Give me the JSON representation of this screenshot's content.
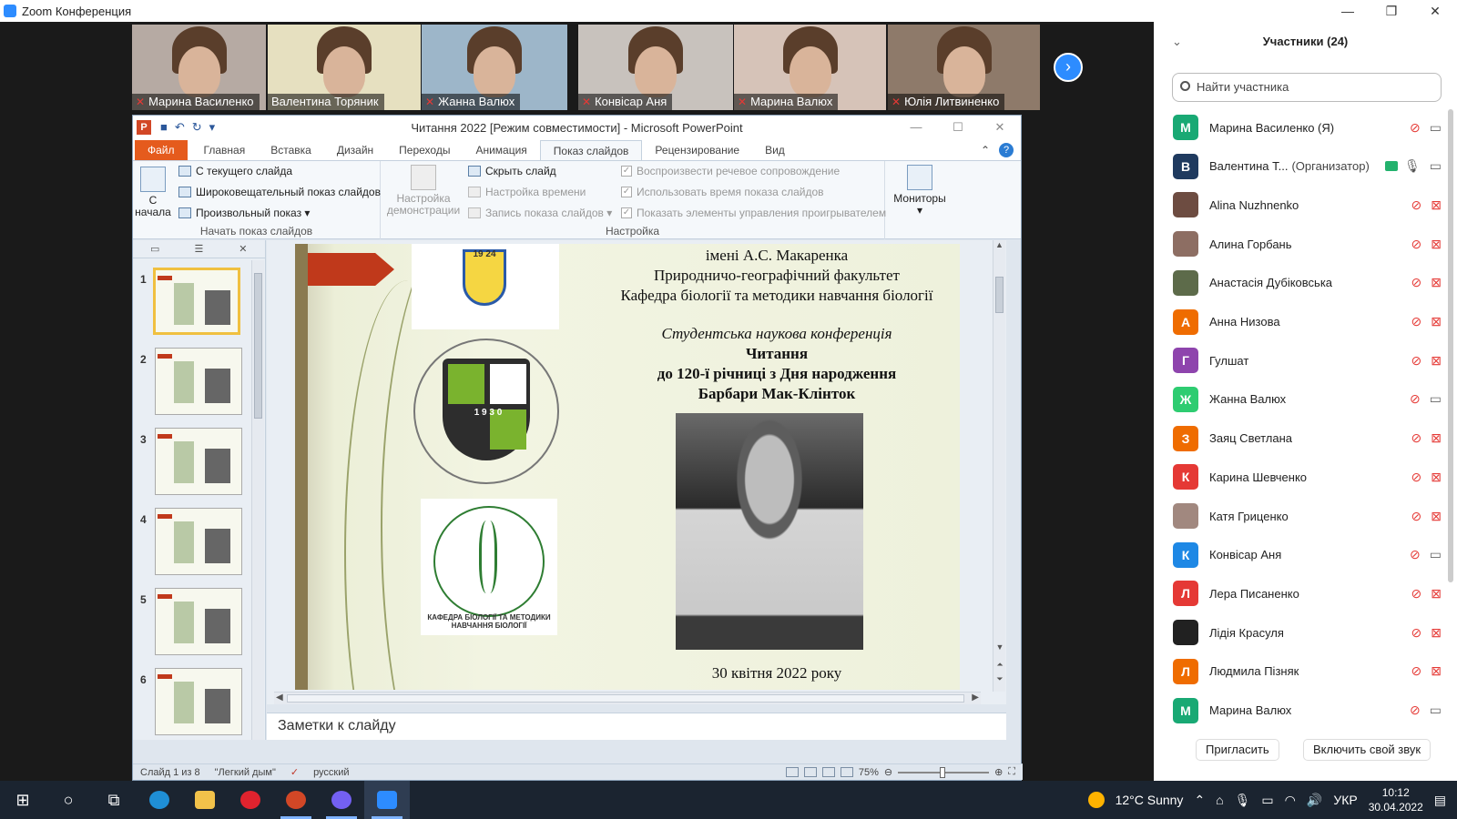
{
  "zoom": {
    "window_title": "Zoom Конференция",
    "window_controls": {
      "minimize": "—",
      "maximize": "❐",
      "close": "✕"
    },
    "gallery": [
      {
        "name": "Марина Василенко",
        "muted": true,
        "bg": "#b6aaa3"
      },
      {
        "name": "Валентина Торяник",
        "muted": false,
        "bg": "#e6e0c0"
      },
      {
        "name": "Жанна Валюх",
        "muted": true,
        "bg": "#9db6c9"
      },
      {
        "name": "Конвісар Аня",
        "muted": true,
        "bg": "#c8c2bd"
      },
      {
        "name": "Марина Валюх",
        "muted": true,
        "bg": "#d6c3b8"
      },
      {
        "name": "Юлія Литвиненко",
        "muted": true,
        "bg": "#8e7a6a"
      }
    ],
    "next_icon": "chevron-right-icon"
  },
  "ppt": {
    "title": "Читання 2022 [Режим совместимости] - Microsoft PowerPoint",
    "app_letter": "P",
    "tabs": [
      "Файл",
      "Главная",
      "Вставка",
      "Дизайн",
      "Переходы",
      "Анимация",
      "Показ слайдов",
      "Рецензирование",
      "Вид"
    ],
    "active_tab": "Показ слайдов",
    "ribbon": {
      "from_start_line1": "С",
      "from_start_line2": "начала",
      "from_current": "С текущего слайда",
      "broadcast": "Широковещательный показ слайдов",
      "custom_show": "Произвольный показ ▾",
      "group_start": "Начать показ слайдов",
      "setup_line1": "Настройка",
      "setup_line2": "демонстрации",
      "hide_slide": "Скрыть слайд",
      "rehearse": "Настройка времени",
      "record": "Запись показа слайдов ▾",
      "play_narrations": "Воспроизвести речевое сопровождение",
      "use_timings": "Использовать время показа слайдов",
      "show_controls": "Показать элементы управления проигрывателем",
      "group_setup": "Настройка",
      "monitors": "Мониторы",
      "monitors_arrow": "▾"
    },
    "thumbnails": [
      {
        "num": "1",
        "selected": true
      },
      {
        "num": "2",
        "selected": false
      },
      {
        "num": "3",
        "selected": false
      },
      {
        "num": "4",
        "selected": false
      },
      {
        "num": "5",
        "selected": false
      },
      {
        "num": "6",
        "selected": false
      }
    ],
    "slide": {
      "logo_year": "19 24",
      "logo2_year": "1 9 3 0",
      "logo3_caption": "КАФЕДРА БІОЛОГІЇ ТА МЕТОДИКИ НАВЧАННЯ БІОЛОГІЇ",
      "line1": "імені А.С. Макаренка",
      "line2": "Природничо-географічний факультет",
      "line3": "Кафедра біології  та методики навчання біології",
      "conf": "Студентська наукова конференція",
      "readings": "Читання",
      "anniv": "до 120-ї річниці з Дня народження",
      "person": "Барбари Мак-Клінток",
      "date": "30 квітня 2022 року"
    },
    "notes_placeholder": "Заметки к слайду",
    "status": {
      "slide_info": "Слайд 1 из 8",
      "theme": "\"Легкий дым\"",
      "language": "русский",
      "zoom": "75%"
    }
  },
  "participants": {
    "header": "Участники (24)",
    "search_placeholder": "Найти участника",
    "list": [
      {
        "initial": "М",
        "color": "#19a974",
        "name": "Марина Василенко (Я)",
        "role": "",
        "mic_on": false,
        "cam_on": true,
        "share": false
      },
      {
        "initial": "В",
        "color": "#1f3a5f",
        "name": "Валентина Т...",
        "role": "(Организатор)",
        "mic_on": true,
        "cam_on": true,
        "share": true
      },
      {
        "initial": "",
        "color": "#6d4c41",
        "name": "Alina Nuzhnenko",
        "role": "",
        "mic_on": false,
        "cam_on": false,
        "share": false
      },
      {
        "initial": "",
        "color": "#8d6e63",
        "name": "Алина Горбань",
        "role": "",
        "mic_on": false,
        "cam_on": false,
        "share": false
      },
      {
        "initial": "",
        "color": "#5d6b4a",
        "name": "Анастасія Дубіковська",
        "role": "",
        "mic_on": false,
        "cam_on": false,
        "share": false
      },
      {
        "initial": "А",
        "color": "#ef6c00",
        "name": "Анна Низова",
        "role": "",
        "mic_on": false,
        "cam_on": false,
        "share": false
      },
      {
        "initial": "Г",
        "color": "#8e44ad",
        "name": "Гулшат",
        "role": "",
        "mic_on": false,
        "cam_on": false,
        "share": false
      },
      {
        "initial": "Ж",
        "color": "#2ecc71",
        "name": "Жанна Валюх",
        "role": "",
        "mic_on": false,
        "cam_on": true,
        "share": false
      },
      {
        "initial": "З",
        "color": "#ef6c00",
        "name": "Заяц Светлана",
        "role": "",
        "mic_on": false,
        "cam_on": false,
        "share": false
      },
      {
        "initial": "К",
        "color": "#e53935",
        "name": "Карина Шевченко",
        "role": "",
        "mic_on": false,
        "cam_on": false,
        "share": false
      },
      {
        "initial": "",
        "color": "#a1887f",
        "name": "Катя Гриценко",
        "role": "",
        "mic_on": false,
        "cam_on": false,
        "share": false
      },
      {
        "initial": "К",
        "color": "#1e88e5",
        "name": "Конвісар Аня",
        "role": "",
        "mic_on": false,
        "cam_on": true,
        "share": false
      },
      {
        "initial": "Л",
        "color": "#e53935",
        "name": "Лера Писаненко",
        "role": "",
        "mic_on": false,
        "cam_on": false,
        "share": false
      },
      {
        "initial": "",
        "color": "#212121",
        "name": "Лідія Красуля",
        "role": "",
        "mic_on": false,
        "cam_on": false,
        "share": false
      },
      {
        "initial": "Л",
        "color": "#ef6c00",
        "name": "Людмила Пізняк",
        "role": "",
        "mic_on": false,
        "cam_on": false,
        "share": false
      },
      {
        "initial": "М",
        "color": "#19a974",
        "name": "Марина Валюх",
        "role": "",
        "mic_on": false,
        "cam_on": true,
        "share": false
      }
    ],
    "invite": "Пригласить",
    "unmute": "Включить свой звук"
  },
  "taskbar": {
    "weather": "12°C  Sunny",
    "language": "УКР",
    "time": "10:12",
    "date": "30.04.2022"
  }
}
